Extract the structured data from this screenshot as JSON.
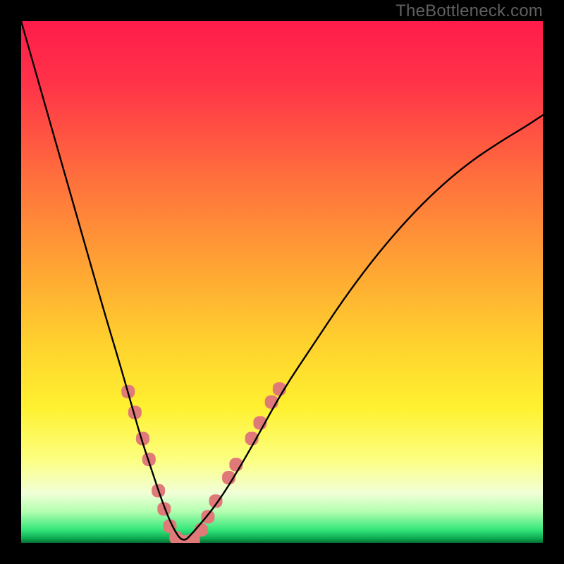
{
  "watermark": {
    "text": "TheBottleneck.com"
  },
  "chart_data": {
    "type": "line",
    "title": "",
    "xlabel": "",
    "ylabel": "",
    "ylim": [
      0,
      100
    ],
    "xlim": [
      0,
      100
    ],
    "x": [
      0,
      4,
      8,
      12,
      16,
      19,
      21,
      23,
      25,
      27,
      29,
      31,
      33,
      38,
      44,
      50,
      56,
      62,
      68,
      74,
      80,
      86,
      92,
      97,
      100
    ],
    "values": [
      100,
      86,
      72,
      58,
      44,
      34,
      27,
      20,
      14,
      8,
      3,
      0,
      2,
      8,
      18,
      29,
      38,
      47,
      55,
      62,
      68,
      73,
      77,
      80,
      82
    ],
    "curve_note": "V-shaped bottleneck curve; minimum near x≈31 at y≈0",
    "markers": {
      "note": "salmon rounded markers along lower portion of both branches",
      "color": "#e07a78",
      "points": [
        {
          "x": 20.5,
          "y": 29
        },
        {
          "x": 21.8,
          "y": 25
        },
        {
          "x": 23.3,
          "y": 20
        },
        {
          "x": 24.5,
          "y": 16
        },
        {
          "x": 26.3,
          "y": 10
        },
        {
          "x": 27.4,
          "y": 6.5
        },
        {
          "x": 28.5,
          "y": 3.2
        },
        {
          "x": 29.7,
          "y": 1.0
        },
        {
          "x": 31.3,
          "y": 0.2
        },
        {
          "x": 33.0,
          "y": 0.6
        },
        {
          "x": 34.5,
          "y": 2.5
        },
        {
          "x": 35.8,
          "y": 5.0
        },
        {
          "x": 37.3,
          "y": 8.0
        },
        {
          "x": 39.8,
          "y": 12.5
        },
        {
          "x": 41.2,
          "y": 15.0
        },
        {
          "x": 44.2,
          "y": 20.0
        },
        {
          "x": 45.8,
          "y": 23.0
        },
        {
          "x": 48.0,
          "y": 27.0
        },
        {
          "x": 49.5,
          "y": 29.5
        }
      ]
    },
    "gradient": {
      "note": "vertical red→orange→yellow→pale→green with thin dark green bottom edge",
      "stops": [
        {
          "offset": 0.0,
          "color": "#ff1c4b"
        },
        {
          "offset": 0.12,
          "color": "#ff3348"
        },
        {
          "offset": 0.3,
          "color": "#ff6f3d"
        },
        {
          "offset": 0.48,
          "color": "#ffa733"
        },
        {
          "offset": 0.62,
          "color": "#ffd22e"
        },
        {
          "offset": 0.74,
          "color": "#fff130"
        },
        {
          "offset": 0.84,
          "color": "#fcff80"
        },
        {
          "offset": 0.905,
          "color": "#f1ffd8"
        },
        {
          "offset": 0.94,
          "color": "#b3ffb0"
        },
        {
          "offset": 0.975,
          "color": "#35e67a"
        },
        {
          "offset": 0.992,
          "color": "#0aa850"
        },
        {
          "offset": 1.0,
          "color": "#066b34"
        }
      ]
    }
  }
}
